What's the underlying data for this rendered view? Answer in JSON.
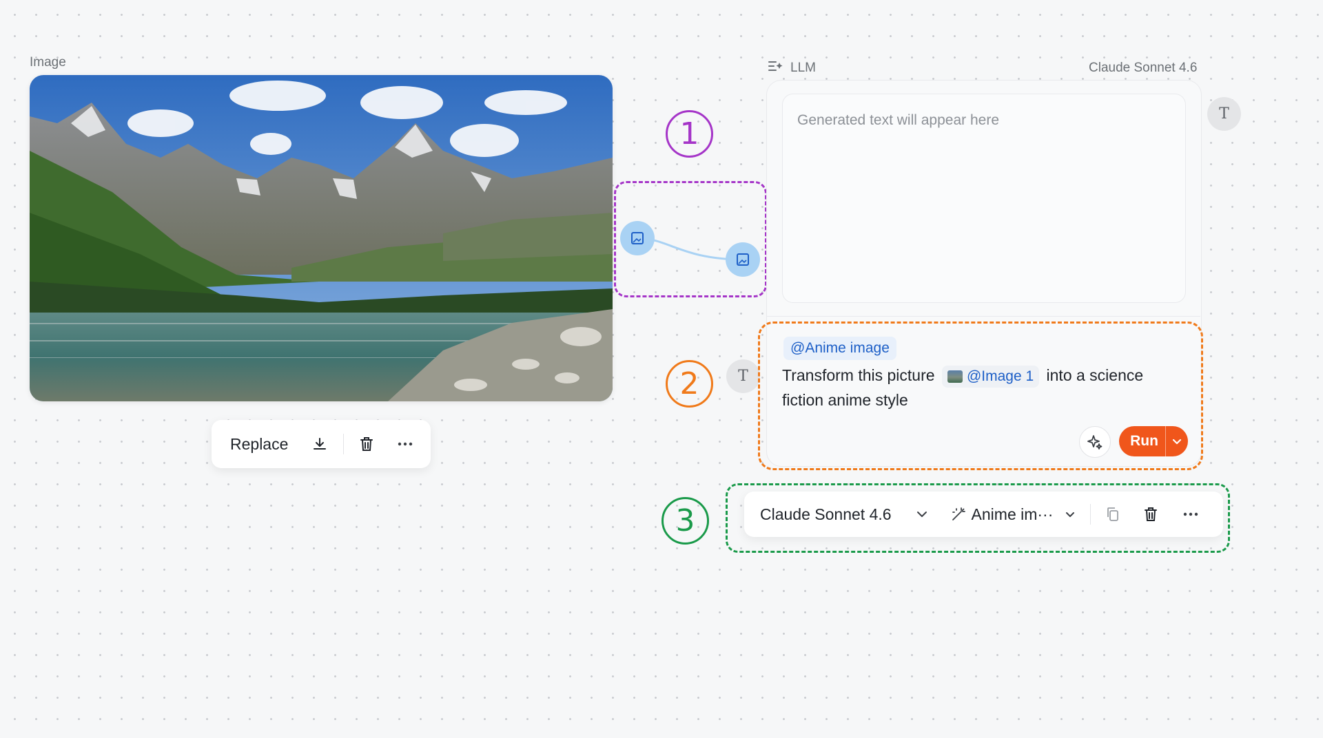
{
  "image_node": {
    "label": "Image",
    "toolbar": {
      "replace_label": "Replace"
    }
  },
  "llm_node": {
    "header_label": "LLM",
    "header_model": "Claude Sonnet 4.6",
    "output_placeholder": "Generated text will appear here",
    "prompt": {
      "mention": "@Anime image",
      "text_before": "Transform this picture",
      "image_chip": "@Image 1",
      "text_after": "into a science fiction anime style"
    },
    "run_label": "Run",
    "avatar_letter": "T"
  },
  "llm_toolbar": {
    "model": "Claude Sonnet 4.6",
    "preset": "Anime im···"
  },
  "annotations": [
    {
      "number": "1",
      "color": "#a535c8"
    },
    {
      "number": "2",
      "color": "#f07a1a"
    },
    {
      "number": "3",
      "color": "#1a9a4a"
    }
  ],
  "colors": {
    "accent_run": "#f0561b",
    "mention_blue": "#1d5fc7",
    "connector_blue": "#a9d2f4"
  },
  "icons": [
    "download-icon",
    "trash-icon",
    "more-icon",
    "image-port-icon",
    "sparkle-icon",
    "chevron-down-icon",
    "magic-wand-icon",
    "copy-icon",
    "llm-icon"
  ]
}
